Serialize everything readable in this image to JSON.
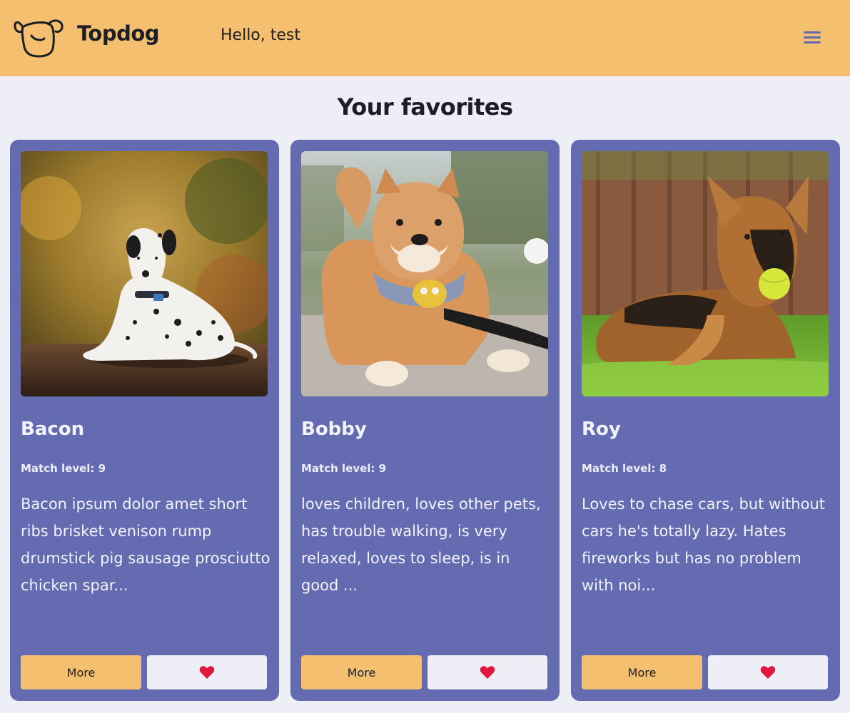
{
  "app": {
    "brand": "Topdog",
    "greeting": "Hello, test",
    "logo_icon": "dog-face-icon",
    "menu_icon": "hamburger-menu-icon"
  },
  "page": {
    "title": "Your favorites"
  },
  "colors": {
    "header": "#f4bf6e",
    "background": "#eeeff6",
    "card": "#646bb1",
    "heart": "#e0173f"
  },
  "cards": [
    {
      "name": "Bacon",
      "match": "Match level: 9",
      "description": "Bacon ipsum dolor amet short ribs brisket venison rump drumstick pig sausage prosciutto chicken spar...",
      "more_label": "More",
      "favorite_icon": "heart-icon",
      "photo": "dalmatian-dog-photo"
    },
    {
      "name": "Bobby",
      "match": "Match level: 9",
      "description": "loves children, loves other pets, has trouble walking, is very relaxed, loves to sleep, is in good ...",
      "more_label": "More",
      "favorite_icon": "heart-icon",
      "photo": "shiba-inu-dog-photo"
    },
    {
      "name": "Roy",
      "match": "Match level: 8",
      "description": "Loves to chase cars, but without cars he's totally lazy. Hates fireworks but has no problem with noi...",
      "more_label": "More",
      "favorite_icon": "heart-icon",
      "photo": "german-shepherd-dog-photo"
    }
  ]
}
